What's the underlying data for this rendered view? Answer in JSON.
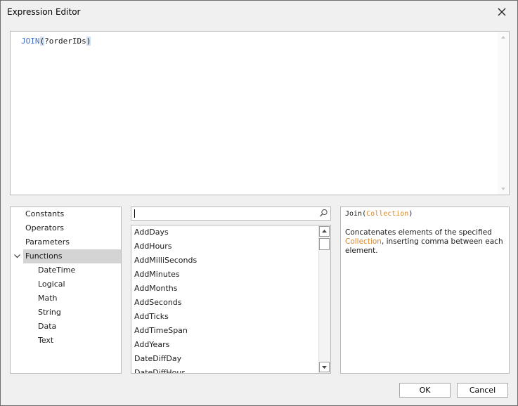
{
  "window": {
    "title": "Expression Editor"
  },
  "editor": {
    "function_name": "JOIN",
    "open_paren": "(",
    "parameter": "?orderIDs",
    "close_paren": ")"
  },
  "categories": {
    "items": [
      {
        "label": "Constants"
      },
      {
        "label": "Operators"
      },
      {
        "label": "Parameters"
      },
      {
        "label": "Functions",
        "selected": true,
        "expanded": true
      }
    ],
    "function_subitems": [
      {
        "label": "DateTime"
      },
      {
        "label": "Logical"
      },
      {
        "label": "Math"
      },
      {
        "label": "String"
      },
      {
        "label": "Data"
      },
      {
        "label": "Text"
      }
    ]
  },
  "search": {
    "value": "",
    "placeholder": ""
  },
  "functions_list": {
    "items": [
      "AddDays",
      "AddHours",
      "AddMilliSeconds",
      "AddMinutes",
      "AddMonths",
      "AddSeconds",
      "AddTicks",
      "AddTimeSpan",
      "AddYears",
      "DateDiffDay",
      "DateDiffHour"
    ]
  },
  "description": {
    "signature_name": "Join(",
    "signature_param": "Collection",
    "signature_close": ")",
    "text_before": "Concatenates elements of the specified ",
    "text_param": "Collection",
    "text_after": ", inserting comma between each element."
  },
  "buttons": {
    "ok_label": "OK",
    "cancel_label": "Cancel"
  },
  "colors": {
    "function_blue": "#3f6ec6",
    "parameter_orange": "#d9882a",
    "selection_gray": "#d4d4d4"
  }
}
